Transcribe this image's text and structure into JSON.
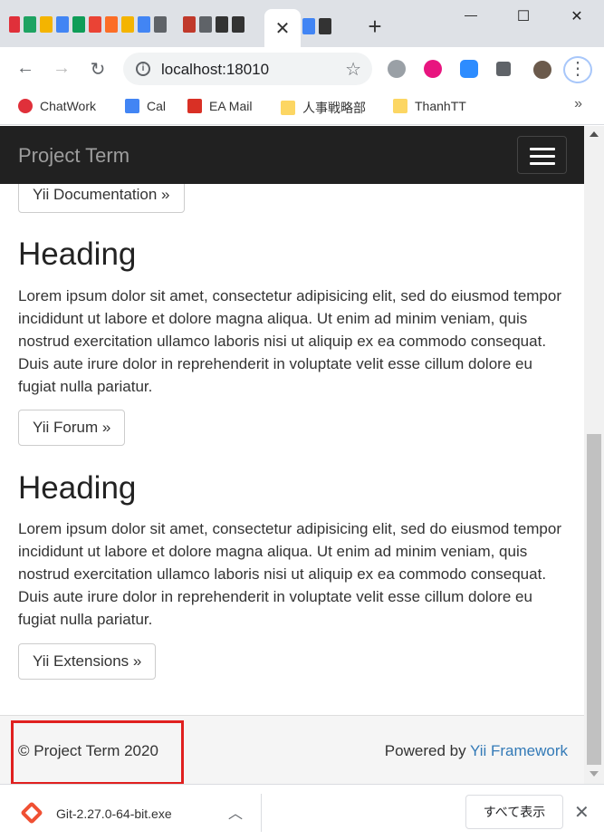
{
  "browser": {
    "url": "localhost:18010",
    "new_tab_symbol": "+",
    "active_tab_close": "✕",
    "win_minimize": "—",
    "win_maximize": "☐",
    "win_close": "✕",
    "back": "←",
    "forward": "→",
    "reload": "↻",
    "star": "☆",
    "menu": "⋮"
  },
  "bookmarks": {
    "items": [
      {
        "label": "ChatWork",
        "color": "#e0303a"
      },
      {
        "label": "Cal",
        "color": "#4285f4"
      },
      {
        "label": "EA Mail",
        "color": "#d93025"
      },
      {
        "label": "人事戦略部",
        "color": "#fcd663"
      },
      {
        "label": "ThanhTT",
        "color": "#fcd663"
      }
    ],
    "more": "»"
  },
  "page": {
    "brand": "Project Term",
    "doc_button": "Yii Documentation »",
    "sections": [
      {
        "heading": "Heading",
        "body": "Lorem ipsum dolor sit amet, consectetur adipisicing elit, sed do eiusmod tempor incididunt ut labore et dolore magna aliqua. Ut enim ad minim veniam, quis nostrud exercitation ullamco laboris nisi ut aliquip ex ea commodo consequat. Duis aute irure dolor in reprehenderit in voluptate velit esse cillum dolore eu fugiat nulla pariatur.",
        "button": "Yii Forum »"
      },
      {
        "heading": "Heading",
        "body": "Lorem ipsum dolor sit amet, consectetur adipisicing elit, sed do eiusmod tempor incididunt ut labore et dolore magna aliqua. Ut enim ad minim veniam, quis nostrud exercitation ullamco laboris nisi ut aliquip ex ea commodo consequat. Duis aute irure dolor in reprehenderit in voluptate velit esse cillum dolore eu fugiat nulla pariatur.",
        "button": "Yii Extensions »"
      }
    ],
    "footer": {
      "copyright": "© Project Term 2020",
      "powered_prefix": "Powered by ",
      "powered_link": "Yii Framework"
    }
  },
  "downloads": {
    "file": "Git-2.27.0-64-bit.exe",
    "chevron": "︿",
    "show_all": "すべて表示",
    "close": "✕"
  },
  "colors": {
    "navbar": "#212121",
    "link": "#337ab7",
    "highlight": "#e0201f"
  }
}
